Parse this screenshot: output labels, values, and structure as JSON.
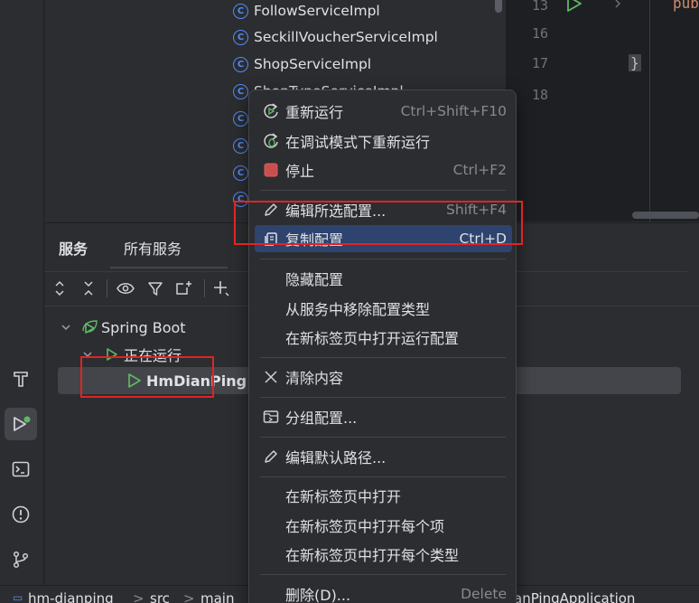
{
  "project_tree": {
    "items": [
      {
        "name": "FollowServiceImpl"
      },
      {
        "name": "SeckillVoucherServiceImpl"
      },
      {
        "name": "ShopServiceImpl"
      },
      {
        "name": "ShopTypeServiceImpl"
      }
    ],
    "class_icon_letter": "C"
  },
  "editor": {
    "line_numbers": [
      "13",
      "16",
      "17",
      "18"
    ],
    "code_pub": "pub",
    "code_brace": "}"
  },
  "services": {
    "tabs": [
      "服务",
      "所有服务"
    ],
    "tree": {
      "spring_boot": "Spring Boot",
      "running": "正在运行",
      "app": "HmDianPing"
    }
  },
  "context_menu": {
    "items": [
      {
        "label": "重新运行",
        "shortcut": "Ctrl+Shift+F10",
        "icon": "rerun-icon"
      },
      {
        "label": "在调试模式下重新运行",
        "shortcut": "",
        "icon": "rerun-debug-icon"
      },
      {
        "label": "停止",
        "shortcut": "Ctrl+F2",
        "icon": "stop-icon"
      },
      {
        "label": "编辑所选配置...",
        "shortcut": "Shift+F4",
        "icon": "pencil-icon"
      },
      {
        "label": "复制配置...",
        "shortcut": "Ctrl+D",
        "icon": "copy-icon"
      },
      {
        "label": "隐藏配置",
        "shortcut": ""
      },
      {
        "label": "从服务中移除配置类型",
        "shortcut": ""
      },
      {
        "label": "在新标签页中打开运行配置",
        "shortcut": ""
      },
      {
        "label": "清除内容",
        "shortcut": "",
        "icon": "close-icon"
      },
      {
        "label": "分组配置...",
        "shortcut": "",
        "icon": "group-icon"
      },
      {
        "label": "编辑默认路径...",
        "shortcut": "",
        "icon": "pencil-icon"
      },
      {
        "label": "在新标签页中打开",
        "shortcut": ""
      },
      {
        "label": "在新标签页中打开每个项",
        "shortcut": ""
      },
      {
        "label": "在新标签页中打开每个类型",
        "shortcut": ""
      },
      {
        "label": "删除(D)...",
        "shortcut": "Delete"
      }
    ]
  },
  "status_bar": {
    "crumbs": [
      "hm-dianping",
      "src",
      "main"
    ],
    "right_text": "anPingApplication",
    "sep": ">"
  },
  "colors": {
    "accent_blue": "#548af7",
    "run_green": "#5fb865",
    "stop_red": "#c94f4f",
    "highlight": "#2e436e",
    "annotation_red": "#e02424"
  }
}
